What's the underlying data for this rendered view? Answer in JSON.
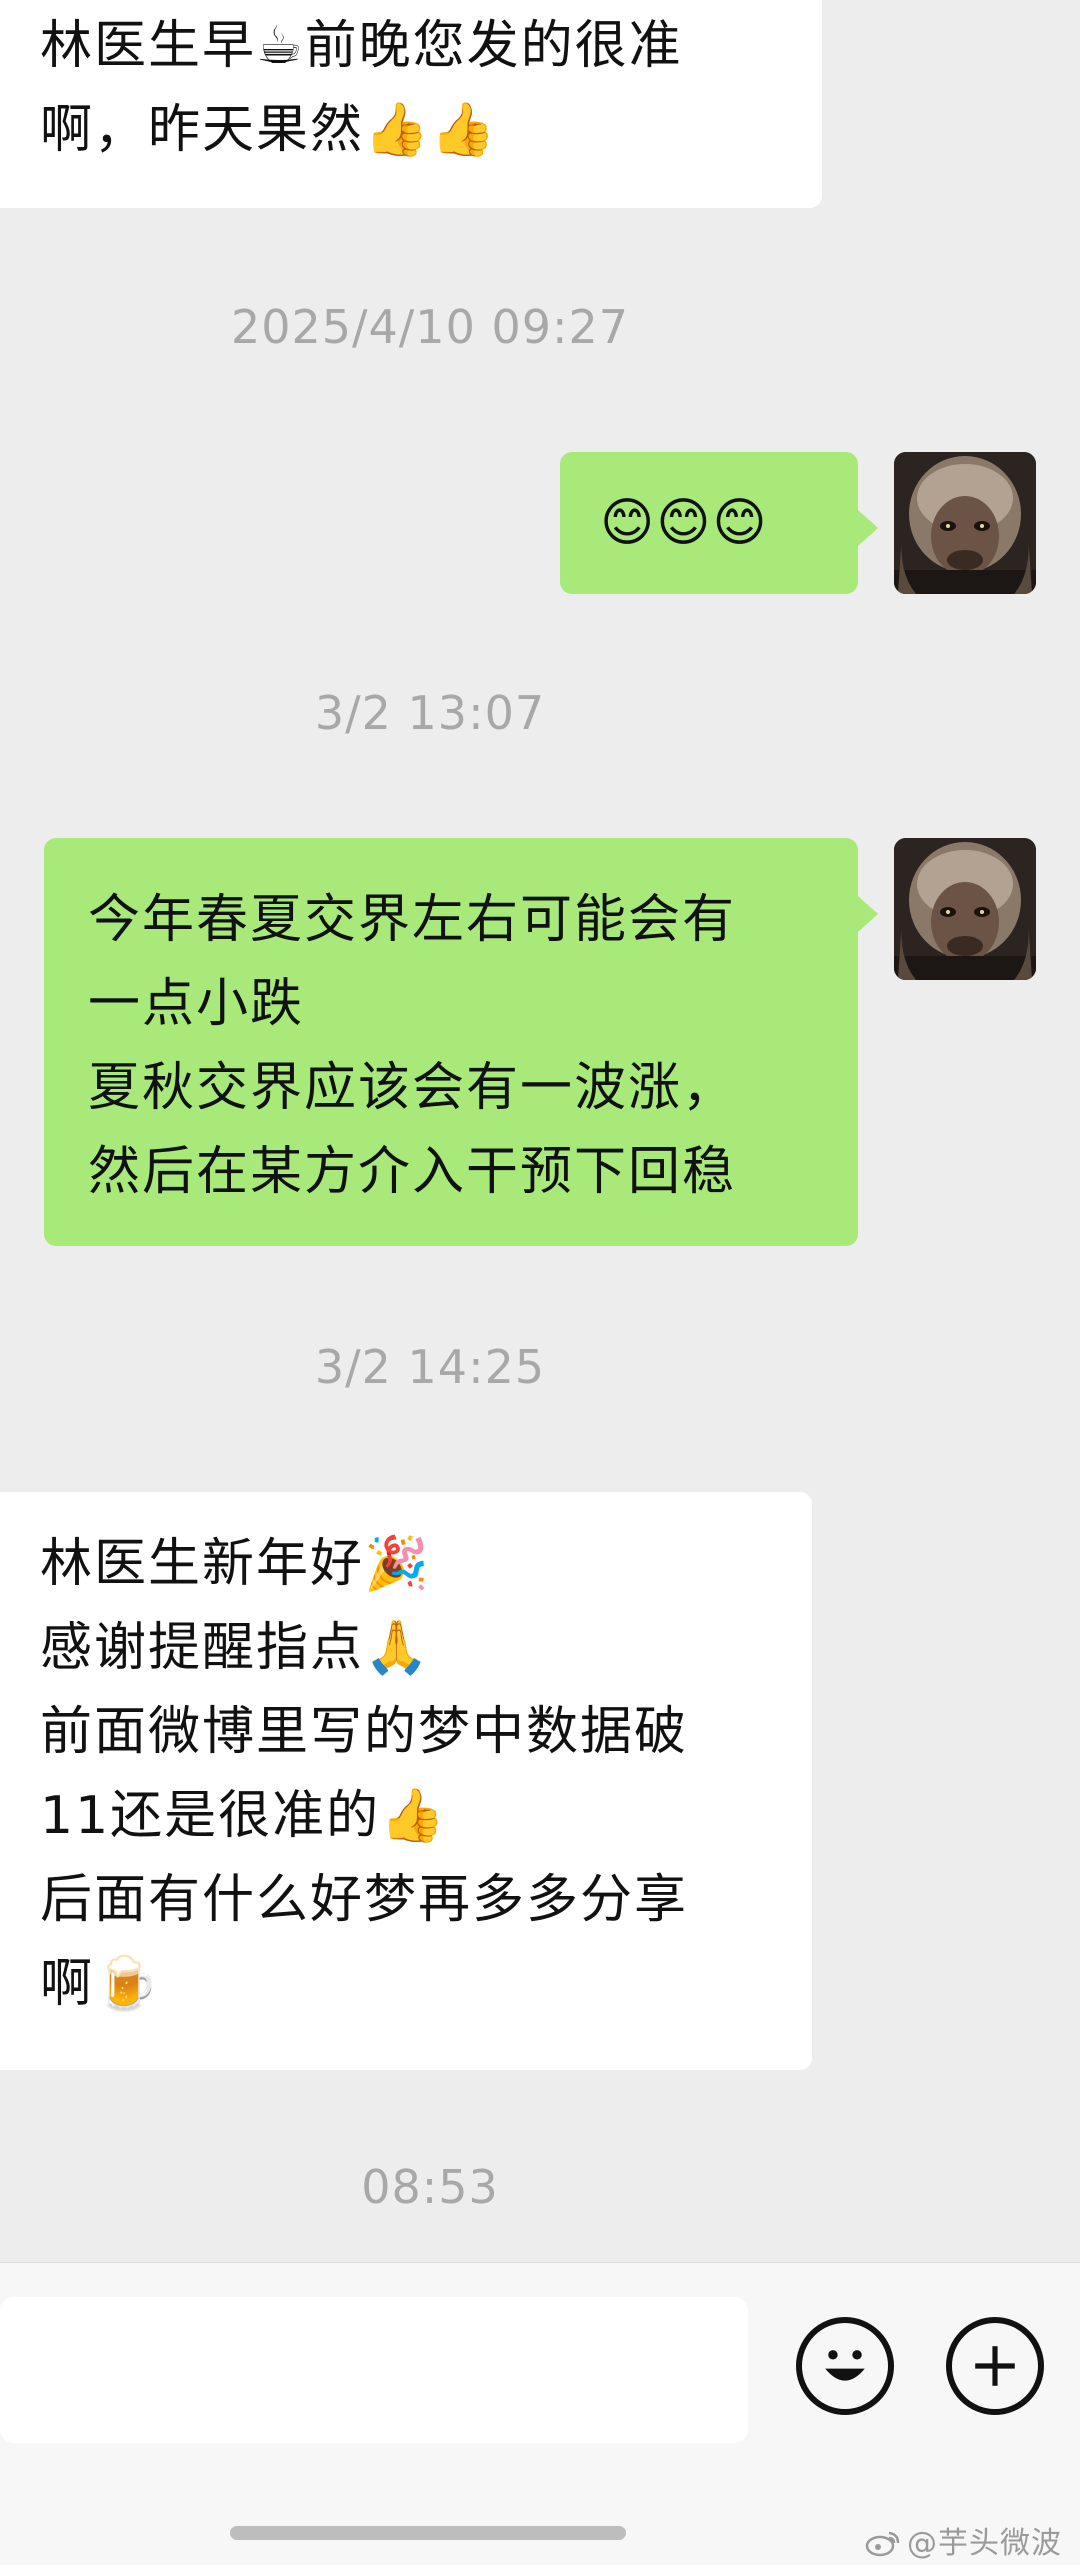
{
  "messages": [
    {
      "type": "in",
      "lines": [
        "林医生早☕前晚您发的很准",
        "啊，昨天果然👍👍"
      ]
    },
    {
      "type": "timestamp",
      "text": "2025/4/10 09:27"
    },
    {
      "type": "out",
      "lines": [
        "😊😊😊"
      ],
      "avatar": "wukong-avatar"
    },
    {
      "type": "timestamp",
      "text": "3/2 13:07"
    },
    {
      "type": "out",
      "lines": [
        "今年春夏交界左右可能会有",
        "一点小跌",
        "夏秋交界应该会有一波涨，",
        "然后在某方介入干预下回稳"
      ],
      "avatar": "wukong-avatar"
    },
    {
      "type": "timestamp",
      "text": "3/2 14:25"
    },
    {
      "type": "in",
      "lines": [
        "林医生新年好🎉",
        "感谢提醒指点🙏",
        "前面微博里写的梦中数据破",
        "11还是很准的👍",
        "后面有什么好梦再多多分享",
        "啊🍺"
      ]
    },
    {
      "type": "timestamp",
      "text": "08:53"
    }
  ],
  "composer": {
    "input_value": "",
    "emoji_icon": "smiley-icon",
    "plus_icon": "plus-circle-icon"
  },
  "watermark": {
    "text": "@芋头微波",
    "icon": "weibo-icon"
  },
  "colors": {
    "background": "#ededed",
    "incoming_bubble": "#ffffff",
    "outgoing_bubble": "#a9e97a",
    "timestamp": "#a8a8a8"
  }
}
